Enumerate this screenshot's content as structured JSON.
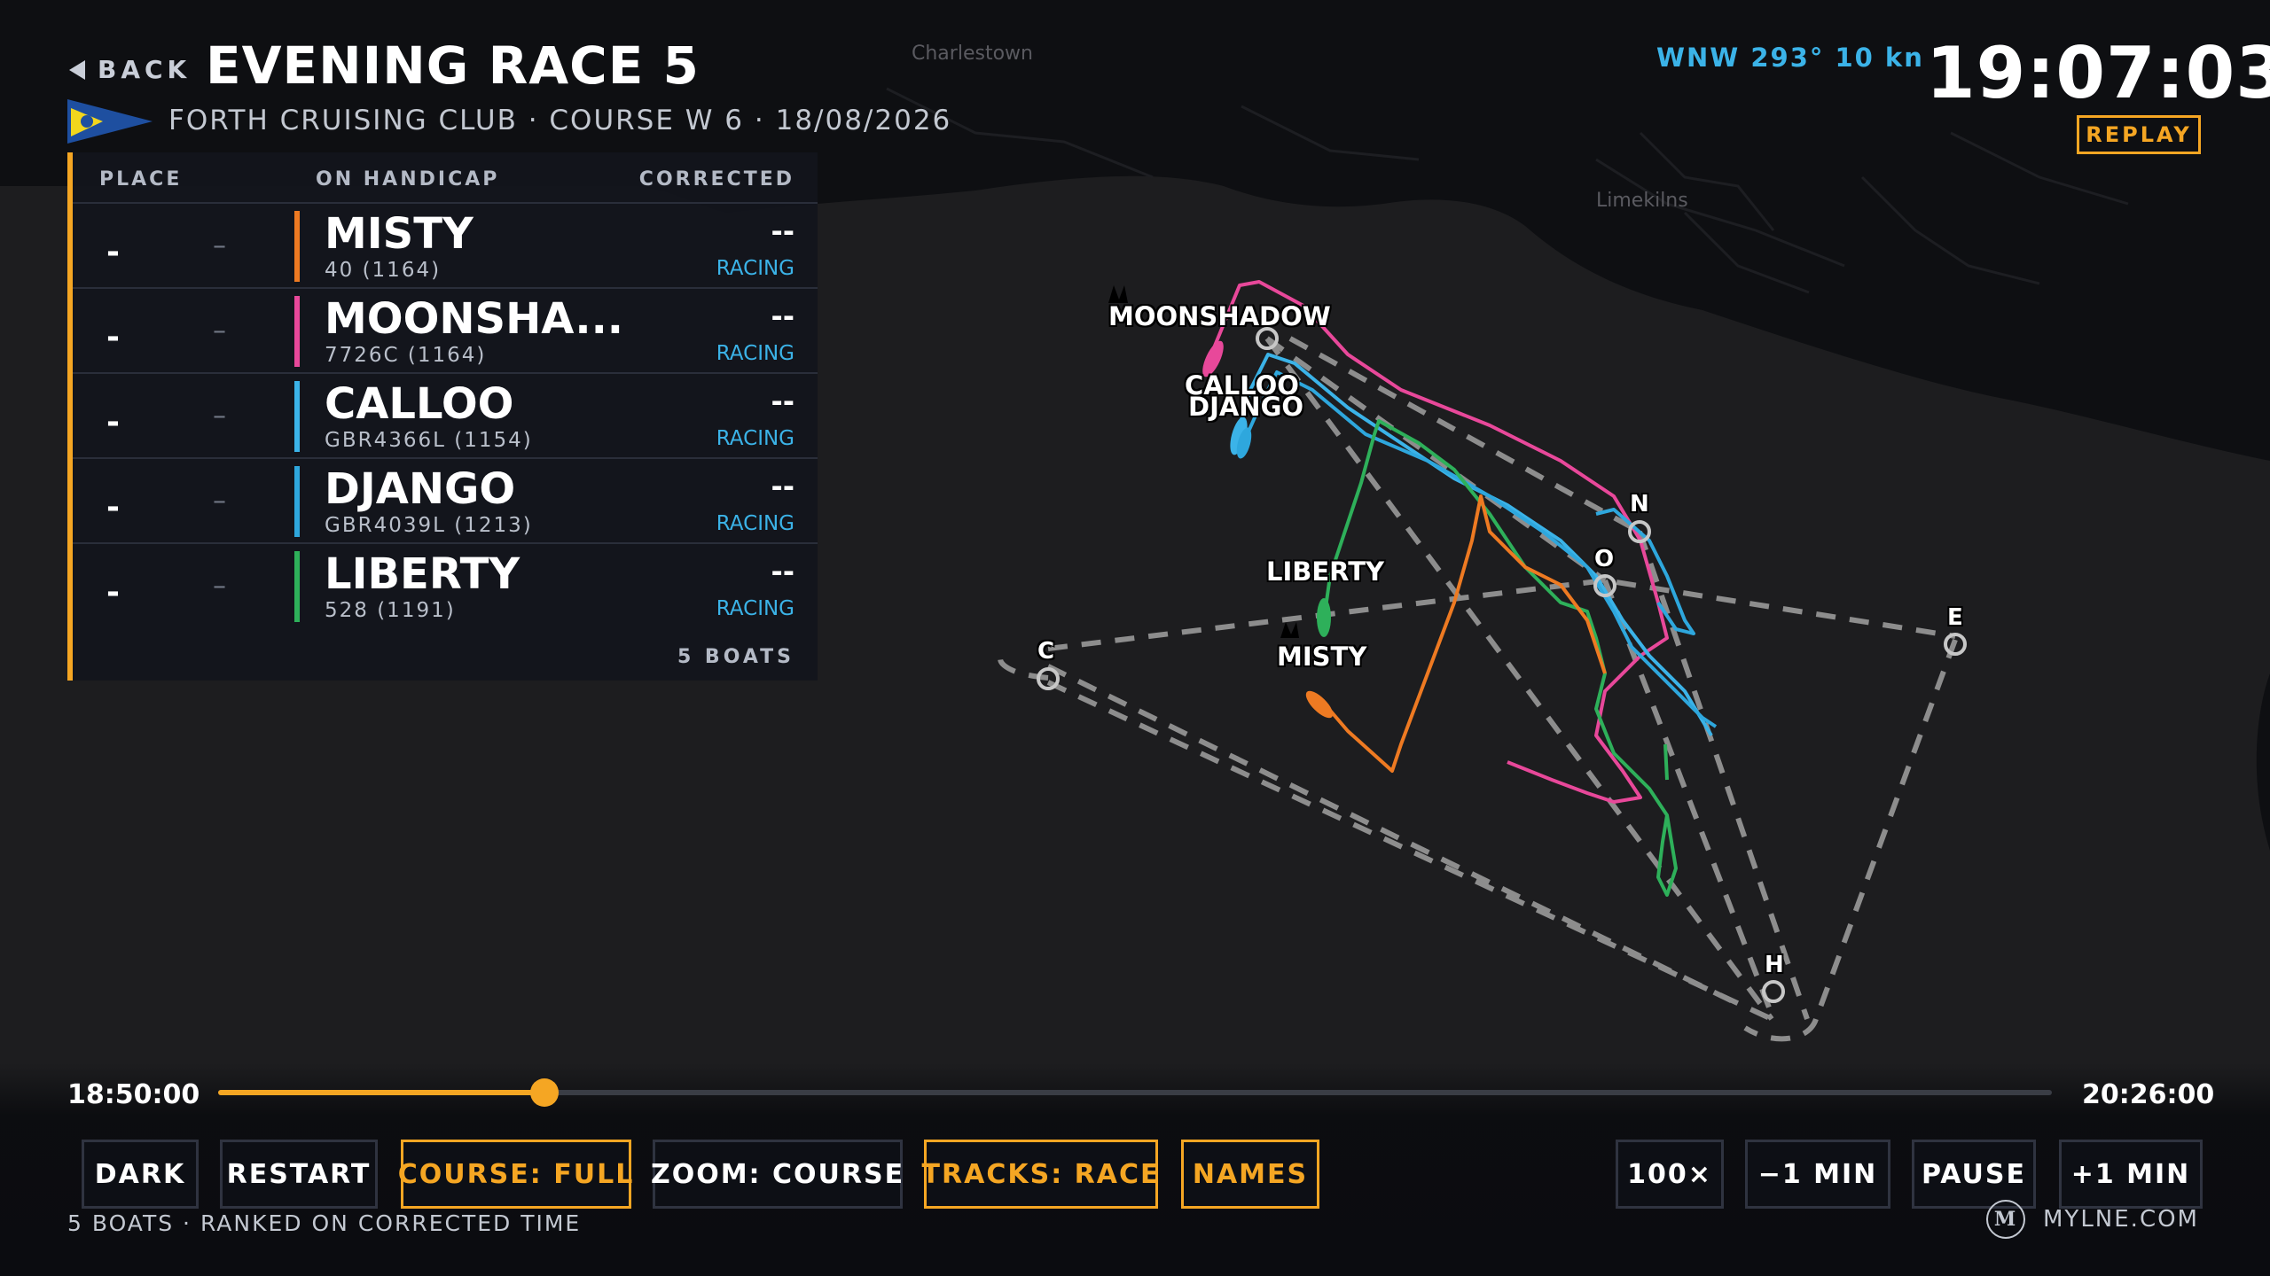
{
  "header": {
    "back_label": "BACK",
    "title": "EVENING RACE 5",
    "subtitle": "FORTH CRUISING CLUB · COURSE W 6 · 18/08/2026",
    "wind": "WNW 293° 10 kn",
    "clock": "19:07:03",
    "mode": "REPLAY"
  },
  "board": {
    "col_place": "PLACE",
    "col_handicap": "ON HANDICAP",
    "col_corrected": "CORRECTED",
    "rows": [
      {
        "place": "-",
        "gap": "–",
        "name": "MISTY",
        "sail": "40 (1164)",
        "corrected": "--",
        "status": "RACING",
        "color": "#ee7a22"
      },
      {
        "place": "-",
        "gap": "–",
        "name": "MOONSHA...",
        "sail": "7726C (1164)",
        "corrected": "--",
        "status": "RACING",
        "color": "#e8489a"
      },
      {
        "place": "-",
        "gap": "–",
        "name": "CALLOO",
        "sail": "GBR4366L (1154)",
        "corrected": "--",
        "status": "RACING",
        "color": "#3bb3e8"
      },
      {
        "place": "-",
        "gap": "–",
        "name": "DJANGO",
        "sail": "GBR4039L (1213)",
        "corrected": "--",
        "status": "RACING",
        "color": "#2ea7dd"
      },
      {
        "place": "-",
        "gap": "–",
        "name": "LIBERTY",
        "sail": "528 (1191)",
        "corrected": "--",
        "status": "RACING",
        "color": "#2eb05a"
      }
    ],
    "footer": "5 BOATS"
  },
  "map": {
    "places": [
      "Charlestown",
      "Limekilns"
    ],
    "boat_labels": {
      "moonshadow": "MOONSHADOW",
      "calloo": "CALLOO",
      "django": "DJANGO",
      "liberty": "LIBERTY",
      "misty": "MISTY"
    },
    "marks": {
      "c": "C",
      "n": "N",
      "o": "O",
      "e": "E",
      "h": "H"
    }
  },
  "timeline": {
    "start": "18:50:00",
    "end": "20:26:00",
    "progress": 0.178
  },
  "controls": {
    "dark": "DARK",
    "restart": "RESTART",
    "course": "COURSE: FULL",
    "zoom": "ZOOM: COURSE",
    "tracks": "TRACKS: RACE",
    "names": "NAMES",
    "speed": "100×",
    "minus": "−1 MIN",
    "pause": "PAUSE",
    "plus": "+1 MIN"
  },
  "footer": {
    "note": "5 BOATS · RANKED ON CORRECTED TIME",
    "brand_logo": "M",
    "brand": "MYLNE.COM"
  }
}
